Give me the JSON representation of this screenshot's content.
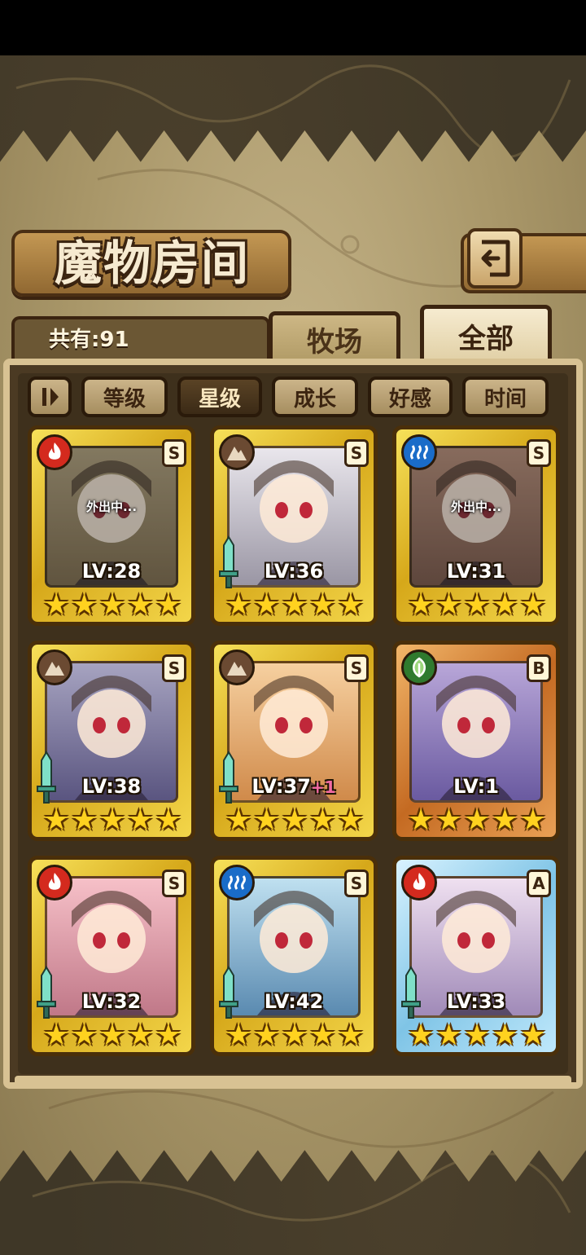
{
  "title": "魔物房间",
  "count_label": "共有:91",
  "tabs": [
    {
      "label": "牧场",
      "active": false
    },
    {
      "label": "全部",
      "active": true
    }
  ],
  "sort_buttons": [
    {
      "label": "等级",
      "active": false
    },
    {
      "label": "星级",
      "active": true
    },
    {
      "label": "成长",
      "active": false
    },
    {
      "label": "好感",
      "active": false
    },
    {
      "label": "时间",
      "active": false
    }
  ],
  "away_label": "外出中...",
  "colors": {
    "fire": "#d42a1e",
    "earth": "#6b4a32",
    "water": "#1a6cc8",
    "wind": "#2f7a2e"
  },
  "cards": [
    {
      "element": "fire",
      "rank": "S",
      "level": "LV:28",
      "bonus": "",
      "stars": 5,
      "frame": "gold",
      "away": true,
      "weapon": false
    },
    {
      "element": "earth",
      "rank": "S",
      "level": "LV:36",
      "bonus": "",
      "stars": 5,
      "frame": "gold",
      "away": false,
      "weapon": true
    },
    {
      "element": "water",
      "rank": "S",
      "level": "LV:31",
      "bonus": "",
      "stars": 5,
      "frame": "gold",
      "away": true,
      "weapon": false
    },
    {
      "element": "earth",
      "rank": "S",
      "level": "LV:38",
      "bonus": "",
      "stars": 5,
      "frame": "gold",
      "away": false,
      "weapon": true
    },
    {
      "element": "earth",
      "rank": "S",
      "level": "LV:37",
      "bonus": "+1",
      "stars": 5,
      "frame": "gold",
      "away": false,
      "weapon": true
    },
    {
      "element": "wind",
      "rank": "B",
      "level": "LV:1",
      "bonus": "",
      "stars": 5,
      "frame": "bronze",
      "away": false,
      "weapon": false
    },
    {
      "element": "fire",
      "rank": "S",
      "level": "LV:32",
      "bonus": "",
      "stars": 5,
      "frame": "gold",
      "away": false,
      "weapon": true
    },
    {
      "element": "water",
      "rank": "S",
      "level": "LV:42",
      "bonus": "",
      "stars": 5,
      "frame": "gold",
      "away": false,
      "weapon": true
    },
    {
      "element": "fire",
      "rank": "A",
      "level": "LV:33",
      "bonus": "",
      "stars": 5,
      "frame": "ice",
      "away": false,
      "weapon": true
    }
  ]
}
